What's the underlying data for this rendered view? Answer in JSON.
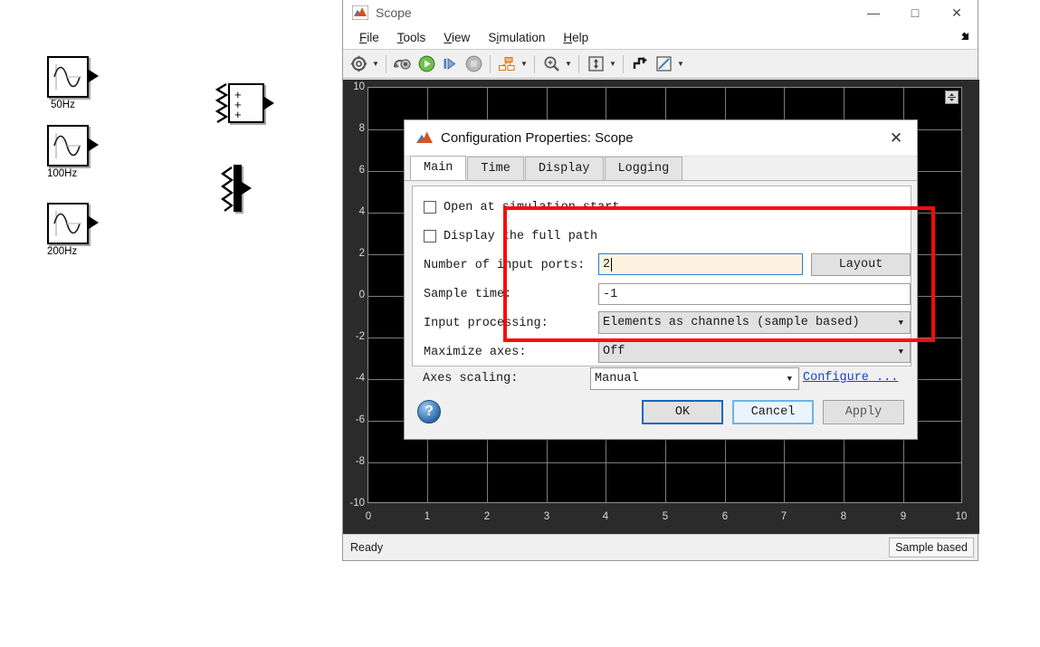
{
  "canvas": {
    "blocks": [
      {
        "type": "sine-wave-source",
        "label": "50Hz",
        "icon": "sine-wave-icon"
      },
      {
        "type": "sine-wave-source",
        "label": "100Hz",
        "icon": "sine-wave-icon"
      },
      {
        "type": "sine-wave-source",
        "label": "200Hz",
        "icon": "sine-wave-icon"
      },
      {
        "type": "add-block",
        "label": "",
        "signs": [
          "+",
          "+",
          "+"
        ],
        "icon": "sum-block-icon"
      },
      {
        "type": "mux-block",
        "label": "",
        "icon": "mux-block-icon"
      }
    ]
  },
  "scope": {
    "title": "Scope",
    "window_buttons": {
      "minimize": "—",
      "maximize": "□",
      "close": "✕"
    },
    "menu": [
      {
        "label": "File",
        "mnemonic": "F"
      },
      {
        "label": "Tools",
        "mnemonic": "T"
      },
      {
        "label": "View",
        "mnemonic": "V"
      },
      {
        "label": "Simulation",
        "mnemonic": "S"
      },
      {
        "label": "Help",
        "mnemonic": "H"
      }
    ],
    "menu_expand_icon": "expand-arrow-icon",
    "toolbar": [
      {
        "name": "configuration-properties-icon",
        "caret": true
      },
      {
        "name": "simulink-link-icon",
        "caret": false
      },
      {
        "name": "run-icon",
        "caret": false
      },
      {
        "name": "step-forward-icon",
        "caret": false
      },
      {
        "name": "stop-icon",
        "caret": false
      },
      {
        "name": "signal-selection-icon",
        "caret": true
      },
      {
        "name": "zoom-in-icon",
        "caret": true
      },
      {
        "name": "autoscale-icon",
        "caret": true
      },
      {
        "name": "legend-icon",
        "caret": false
      },
      {
        "name": "measurements-icon",
        "caret": true
      }
    ],
    "plot_expand_icon": "expand-axes-icon",
    "status": {
      "ready": "Ready",
      "mode": "Sample based"
    }
  },
  "chart_data": {
    "type": "line",
    "title": "",
    "xlabel": "",
    "ylabel": "",
    "series": [],
    "x_ticks": [
      "0",
      "1",
      "2",
      "3",
      "4",
      "5",
      "6",
      "7",
      "8",
      "9",
      "10"
    ],
    "y_ticks": [
      "10",
      "8",
      "6",
      "4",
      "2",
      "0",
      "-2",
      "-4",
      "-6",
      "-8",
      "-10"
    ],
    "xlim": [
      0,
      10
    ],
    "ylim": [
      -10,
      10
    ],
    "grid": true,
    "background": "#000000",
    "gridline_color": "#7d7d7d",
    "legend": "none"
  },
  "dialog": {
    "title": "Configuration Properties: Scope",
    "close_label": "✕",
    "tabs": [
      {
        "label": "Main",
        "active": true
      },
      {
        "label": "Time",
        "active": false
      },
      {
        "label": "Display",
        "active": false
      },
      {
        "label": "Logging",
        "active": false
      }
    ],
    "fields": {
      "open_at_simulation_start": {
        "label": "Open at simulation start",
        "checked": false
      },
      "display_the_full_path": {
        "label": "Display the full path",
        "checked": false
      },
      "number_of_input_ports": {
        "label": "Number of input ports:",
        "value": "2",
        "focused": true
      },
      "layout_button": "Layout",
      "sample_time": {
        "label": "Sample time:",
        "value": "-1"
      },
      "input_processing": {
        "label": "Input processing:",
        "value": "Elements as channels (sample based)"
      },
      "maximize_axes": {
        "label": "Maximize axes:",
        "value": "Off"
      },
      "axes_scaling": {
        "label": "Axes scaling:",
        "value": "Manual"
      },
      "configure_link": "Configure ..."
    },
    "help_icon": "help-icon",
    "buttons": [
      {
        "label": "OK",
        "state": "default"
      },
      {
        "label": "Cancel",
        "state": "focusring"
      },
      {
        "label": "Apply",
        "state": "disabled"
      }
    ]
  },
  "annotation": {
    "type": "red-rectangle-highlight",
    "color": "#fb0a0a"
  }
}
